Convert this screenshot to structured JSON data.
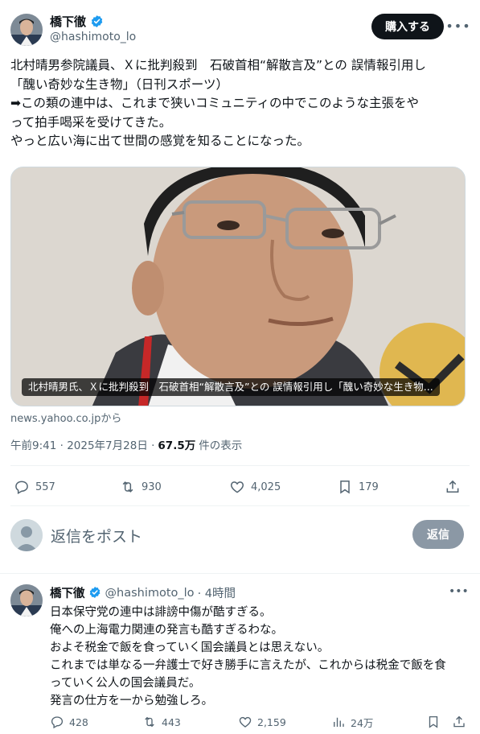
{
  "author": {
    "name": "橋下徹",
    "handle": "@hashimoto_lo"
  },
  "header": {
    "subscribe_label": "購入する"
  },
  "tweet": {
    "lines": [
      "北村晴男参院議員、Ｘに批判殺到　石破首相“解散言及”との 誤情報引用し",
      "「醜い奇妙な生き物」（日刊スポーツ）",
      "➡この類の連中は、これまで狭いコミュニティの中でこのような主張をや",
      "って拍手喝采を受けてきた。",
      "やっと広い海に出て世間の感覚を知ることになった。"
    ],
    "media_caption": "北村晴男氏、Ｘに批判殺到　石破首相“解散言及”との 誤情報引用し「醜い奇妙な生き物...",
    "source": "news.yahoo.co.jpから",
    "timestamp": "午前9:41 · 2025年7月28日 · ",
    "views": "67.5万",
    "views_suffix": " 件の表示"
  },
  "actions": {
    "replies": "557",
    "reposts": "930",
    "likes": "4,025",
    "bookmarks": "179"
  },
  "composer": {
    "placeholder": "返信をポスト",
    "button_label": "返信"
  },
  "reply": {
    "name": "橋下徹",
    "handle": "@hashimoto_lo",
    "time": "· 4時間",
    "lines": [
      "日本保守党の連中は誹謗中傷が酷すぎる。",
      "俺への上海電力関連の発言も酷すぎるわな。",
      "およそ税金で飯を食っていく国会議員とは思えない。",
      "これまでは単なる一弁護士で好き勝手に言えたが、これからは税金で飯を食",
      "っていく公人の国会議員だ。",
      "発言の仕方を一から勉強しろ。"
    ],
    "actions": {
      "replies": "428",
      "reposts": "443",
      "likes": "2,159",
      "views": "24万"
    }
  },
  "colors": {
    "verified": "#1d9bf0",
    "text_secondary": "#536471",
    "reply_button": "#8b98a5"
  }
}
